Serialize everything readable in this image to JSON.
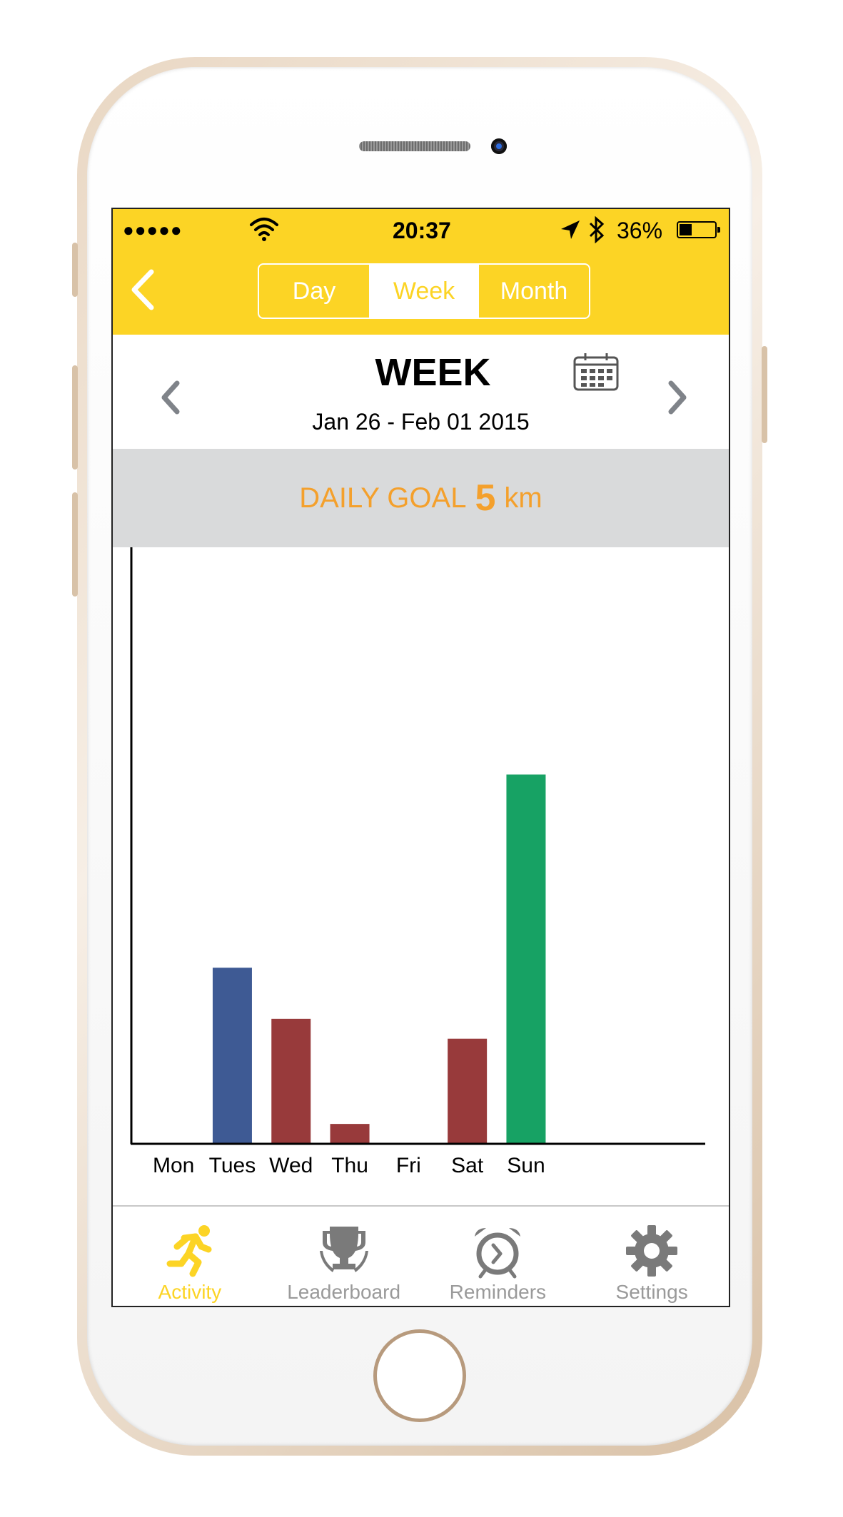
{
  "status_bar": {
    "signal": "●●●●●",
    "time": "20:37",
    "battery_percent": "36%",
    "battery_level": 0.36
  },
  "header": {
    "segments": [
      {
        "label": "Day",
        "active": false
      },
      {
        "label": "Week",
        "active": true
      },
      {
        "label": "Month",
        "active": false
      }
    ]
  },
  "week_nav": {
    "title": "WEEK",
    "range": "Jan 26 - Feb 01 2015"
  },
  "goal": {
    "label": "DAILY GOAL",
    "value": "5",
    "unit": "km"
  },
  "colors": {
    "accent": "#fcd425",
    "goal_text": "#f4a02c",
    "bar_blue": "#3e5a94",
    "bar_red": "#983a3b",
    "bar_green": "#17a264",
    "inactive": "#9a9a9a"
  },
  "chart_data": {
    "type": "bar",
    "categories": [
      "Mon",
      "Tues",
      "Wed",
      "Thu",
      "Fri",
      "Sat",
      "Sun"
    ],
    "values": [
      0,
      3.1,
      2.2,
      0.35,
      0,
      1.85,
      6.5
    ],
    "bar_colors": [
      "#983a3b",
      "#3e5a94",
      "#983a3b",
      "#983a3b",
      "#983a3b",
      "#983a3b",
      "#17a264"
    ],
    "ylim": [
      0,
      10.5
    ],
    "grid": false
  },
  "tabbar": {
    "tabs": [
      {
        "label": "Activity",
        "icon": "running-icon",
        "active": true
      },
      {
        "label": "Leaderboard",
        "icon": "trophy-icon",
        "active": false
      },
      {
        "label": "Reminders",
        "icon": "alarm-clock-icon",
        "active": false
      },
      {
        "label": "Settings",
        "icon": "gear-icon",
        "active": false
      }
    ]
  }
}
